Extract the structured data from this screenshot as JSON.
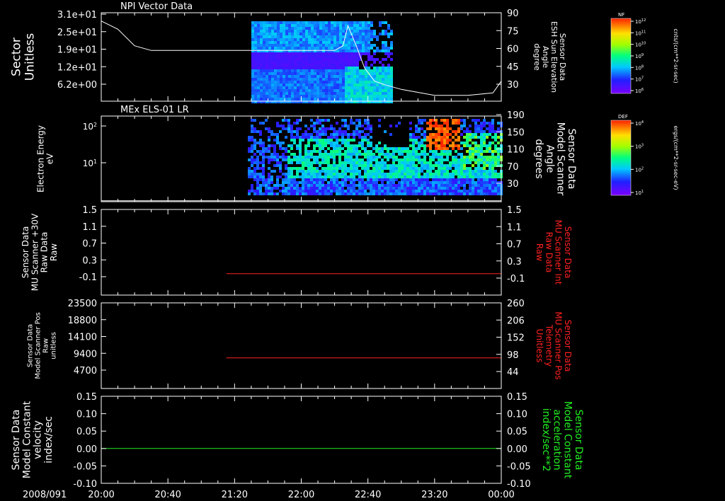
{
  "date_label": "2008/091",
  "colors": {
    "fg": "#ffffff",
    "red": "#ff2020",
    "green": "#22ee22"
  },
  "x_axis": {
    "ticks": [
      "20:00",
      "20:40",
      "21:20",
      "22:00",
      "22:40",
      "23:20",
      "00:00"
    ]
  },
  "chart_data": [
    {
      "type": "heatmap",
      "title": "NPI Vector Data",
      "ylabel": [
        "Sector",
        "Unitless"
      ],
      "left_ticks": [
        "3.1e+01",
        "2.5e+01",
        "1.9e+01",
        "1.2e+01",
        "6.2e+00"
      ],
      "right_ticks": [
        "90",
        "75",
        "60",
        "45",
        "30"
      ],
      "right_label": [
        "Sensor Data",
        "ESH Sun Elevation",
        "Angle",
        "degree"
      ],
      "right_label_color": "#ffffff",
      "overlay_line": {
        "name": "ESH Sun Elevation Angle",
        "y_units": "degree",
        "ylim": [
          15,
          90
        ],
        "points": [
          [
            "20:00",
            83
          ],
          [
            "20:10",
            76
          ],
          [
            "20:20",
            62
          ],
          [
            "20:30",
            58
          ],
          [
            "21:00",
            58
          ],
          [
            "21:40",
            58
          ],
          [
            "22:20",
            58
          ],
          [
            "22:25",
            62
          ],
          [
            "22:28",
            79
          ],
          [
            "22:33",
            62
          ],
          [
            "22:38",
            43
          ],
          [
            "22:44",
            32
          ],
          [
            "22:50",
            29
          ],
          [
            "23:00",
            25
          ],
          [
            "23:20",
            20
          ],
          [
            "23:40",
            20
          ],
          [
            "23:55",
            22
          ],
          [
            "00:00",
            32
          ]
        ]
      },
      "colorbar": {
        "label": "NF",
        "units": "cnts/(cm**2-sr-sec)",
        "ticks": [
          "10^12",
          "10^11",
          "10^10",
          "10^9",
          "10^8",
          "10^7",
          "10^6"
        ]
      }
    },
    {
      "type": "heatmap",
      "title": "MEx ELS-01 LR",
      "ylabel": [
        "Electron Energy",
        "eV"
      ],
      "left_ticks": [
        "10^2",
        "10^1"
      ],
      "right_ticks": [
        "190",
        "150",
        "110",
        "70",
        "30"
      ],
      "right_label": [
        "Sensor Data",
        "Model Scanner",
        "Angle",
        "degrees"
      ],
      "right_label_color": "#ffffff",
      "overlay_line": {
        "name": "Model Scanner Angle",
        "y_units": "degrees",
        "ylim": [
          10,
          190
        ],
        "points": [
          [
            "20:00",
            12
          ],
          [
            "00:00",
            12
          ]
        ]
      },
      "colorbar": {
        "label": "DEF",
        "units": "ergs/(cm**2-sr-sec-eV)",
        "ticks": [
          "10^4",
          "10^3",
          "10^2",
          "10^1"
        ]
      }
    },
    {
      "type": "line",
      "title": "",
      "ylabel": [
        "Sensor Data",
        "MU Scanner +30V",
        "Raw Data",
        "Raw"
      ],
      "left_ticks": [
        "1.5",
        "1.1",
        "0.7",
        "0.3",
        "-0.1"
      ],
      "right_ticks": [
        "1.5",
        "1.1",
        "0.7",
        "0.3",
        "-0.1"
      ],
      "right_label": [
        "Sensor Data",
        "MU Scanner Int",
        "Raw Data",
        "Raw"
      ],
      "right_label_color": "#ff2020",
      "ylim": [
        -0.5,
        1.5
      ],
      "series": [
        {
          "name": "MU Scanner Int",
          "color": "#ff2020",
          "x": [
            "21:15",
            "00:00"
          ],
          "y": [
            0.0,
            0.0
          ]
        }
      ]
    },
    {
      "type": "line",
      "title": "",
      "ylabel": [
        "Sensor Data",
        "Model Scanner Pos",
        "Raw",
        "unitless"
      ],
      "left_ticks": [
        "23500",
        "18800",
        "14100",
        "9400",
        "4700"
      ],
      "right_ticks": [
        "260",
        "206",
        "152",
        "98",
        "44"
      ],
      "right_label": [
        "Sensor Data",
        "MU Scanner Pos",
        "Telemetry",
        "Unitless"
      ],
      "right_label_color": "#ff2020",
      "ylim": [
        0,
        23500
      ],
      "series": [
        {
          "name": "MU Scanner Pos",
          "color": "#ff2020",
          "x": [
            "21:15",
            "00:00"
          ],
          "y": [
            8400,
            8400
          ]
        }
      ]
    },
    {
      "type": "line",
      "title": "",
      "ylabel": [
        "Sensor Data",
        "Model Constant",
        "velocity",
        "index/sec"
      ],
      "left_ticks": [
        "0.15",
        "0.10",
        "0.05",
        "0.00",
        "-0.05",
        "-0.10"
      ],
      "right_ticks": [
        "0.15",
        "0.10",
        "0.05",
        "0.00",
        "-0.05",
        "-0.10"
      ],
      "right_label": [
        "Sensor Data",
        "Model Constant",
        "acceleration",
        "index/sec**2"
      ],
      "right_label_color": "#22ee22",
      "ylim": [
        -0.1,
        0.15
      ],
      "series": [
        {
          "name": "Model Constant acceleration",
          "color": "#22ee22",
          "x": [
            "20:00",
            "00:00"
          ],
          "y": [
            0.0,
            0.0
          ]
        }
      ]
    }
  ]
}
